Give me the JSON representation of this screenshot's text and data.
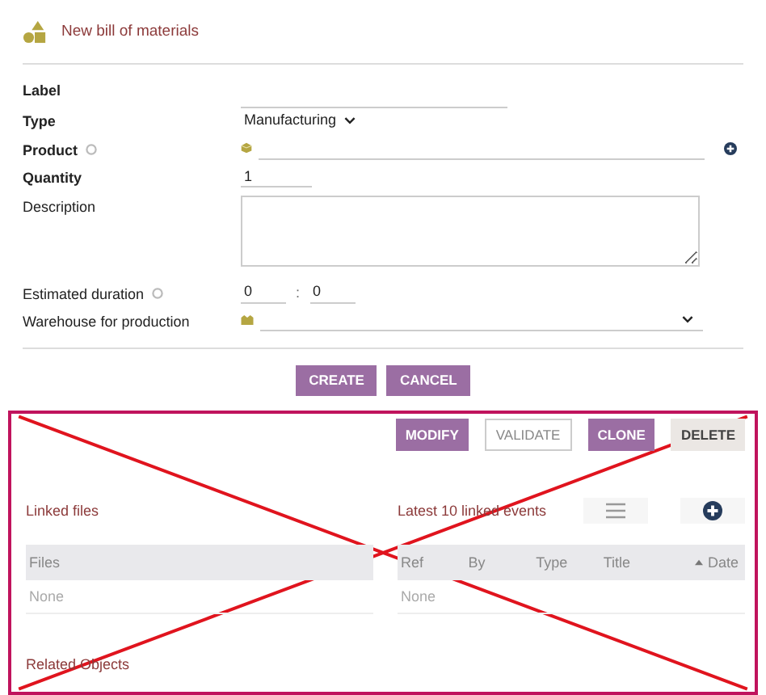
{
  "header": {
    "title": "New bill of materials"
  },
  "fields": [
    {
      "kind": "text",
      "label": "Label",
      "required": true,
      "info": false
    },
    {
      "kind": "select",
      "label": "Type",
      "required": true,
      "info": false,
      "value": "Manufacturing"
    },
    {
      "kind": "product",
      "label": "Product",
      "required": true,
      "info": true
    },
    {
      "kind": "number",
      "label": "Quantity",
      "required": true,
      "info": false,
      "value": "1"
    },
    {
      "kind": "textarea",
      "label": "Description",
      "required": false,
      "info": false
    },
    {
      "kind": "duration",
      "label": "Estimated duration",
      "required": false,
      "info": true,
      "hours": "0",
      "separator": ":",
      "minutes": "0"
    },
    {
      "kind": "warehouse",
      "label": "Warehouse for production",
      "required": false,
      "info": false
    }
  ],
  "buttons": [
    {
      "label": "CREATE"
    },
    {
      "label": "CANCEL"
    }
  ],
  "card": {
    "crossed_out": true,
    "actions": [
      {
        "label": "MODIFY",
        "kind": "primary"
      },
      {
        "label": "VALIDATE",
        "kind": "outline"
      },
      {
        "label": "CLONE",
        "kind": "primary"
      },
      {
        "label": "DELETE",
        "kind": "muted"
      }
    ],
    "linked_files": {
      "title": "Linked files",
      "columns": [
        {
          "label": "Files",
          "sorted": false
        }
      ],
      "empty": "None"
    },
    "linked_events": {
      "title": "Latest 10 linked events",
      "columns": [
        {
          "label": "Ref",
          "sorted": false
        },
        {
          "label": "By",
          "sorted": false
        },
        {
          "label": "Type",
          "sorted": false
        },
        {
          "label": "Title",
          "sorted": false
        },
        {
          "label": "Date",
          "sorted": true
        }
      ],
      "empty": "None"
    },
    "related": {
      "title": "Related Objects"
    }
  }
}
